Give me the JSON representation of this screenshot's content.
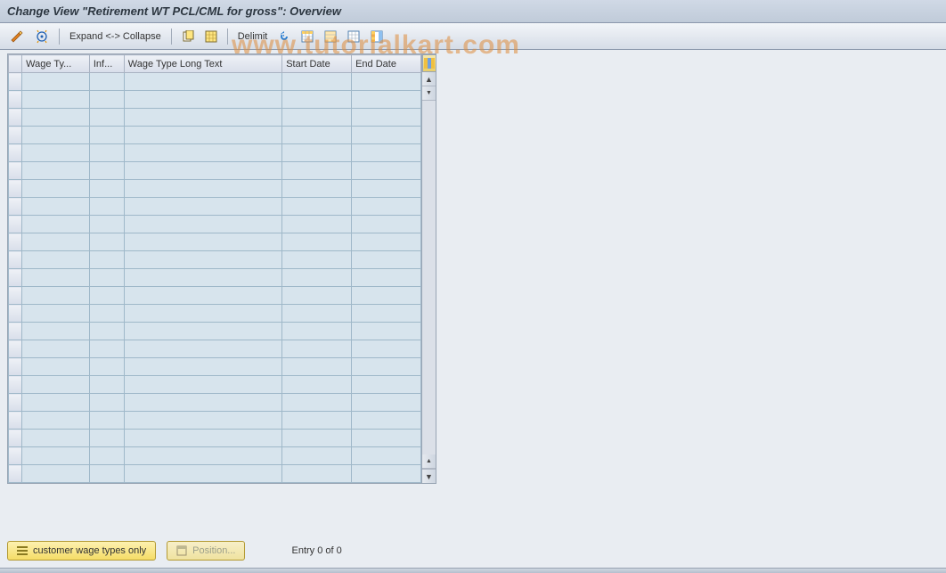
{
  "title": "Change View \"Retirement WT PCL/CML for gross\": Overview",
  "toolbar": {
    "expand_collapse": "Expand <-> Collapse",
    "delimit": "Delimit"
  },
  "watermark": "www.tutorialkart.com",
  "table": {
    "columns": [
      "Wage Ty...",
      "Inf...",
      "Wage Type Long Text",
      "Start Date",
      "End Date"
    ],
    "empty_rows": 23
  },
  "footer": {
    "customer_btn": "customer wage types only",
    "position_btn": "Position...",
    "entry": "Entry 0 of 0"
  }
}
